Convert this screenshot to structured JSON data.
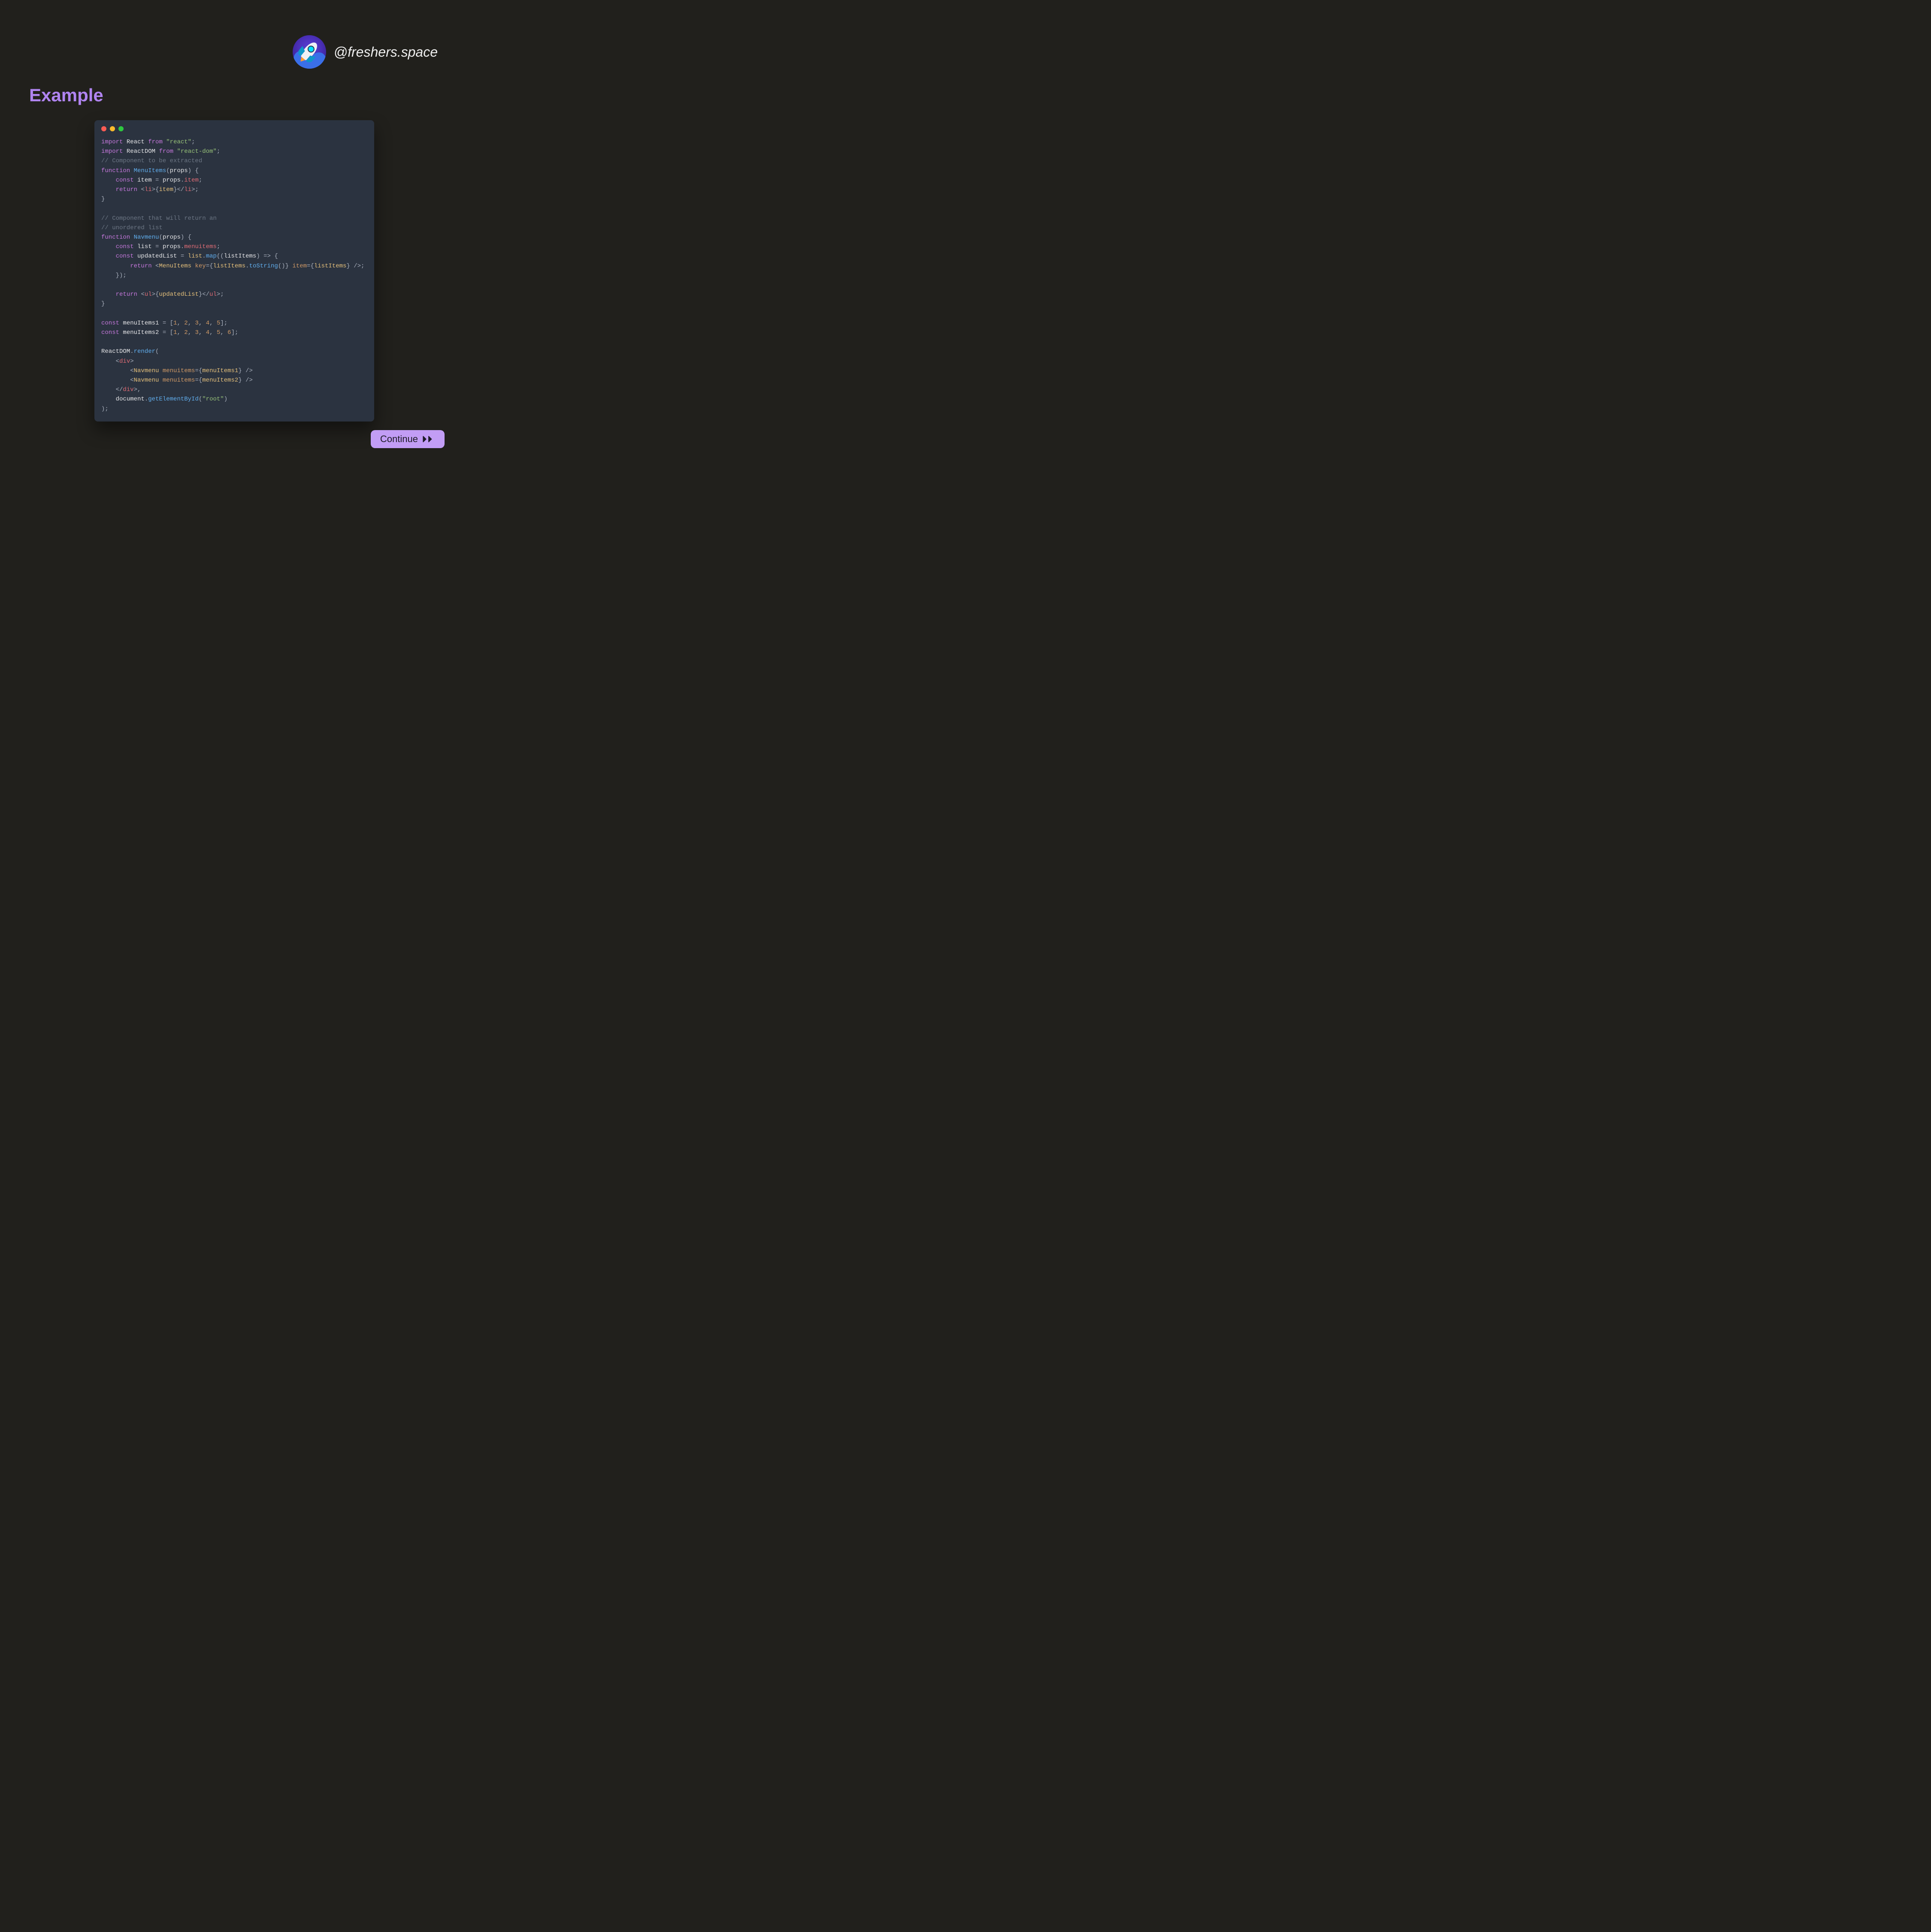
{
  "brand": {
    "handle": "@freshers.space",
    "avatar_alt": "rocket-avatar"
  },
  "title": "Example",
  "code": {
    "language": "javascript",
    "imports": [
      {
        "name": "React",
        "from": "react"
      },
      {
        "name": "ReactDOM",
        "from": "react-dom"
      }
    ],
    "comment_extracted": "// Component to be extracted",
    "fn_menuitems": {
      "name": "MenuItems",
      "param": "props",
      "const_item_lhs": "item",
      "const_item_rhs_obj": "props",
      "const_item_rhs_prop": "item",
      "return_tag": "li",
      "return_expr": "item"
    },
    "comment_navmenu_1": "// Component that will return an",
    "comment_navmenu_2": "// unordered list",
    "fn_navmenu": {
      "name": "Navmenu",
      "param": "props",
      "const_list_lhs": "list",
      "const_list_rhs_obj": "props",
      "const_list_rhs_prop": "menuitems",
      "const_upd_lhs": "updatedList",
      "map_src": "list",
      "map_call": "map",
      "map_arg": "listItems",
      "map_return_comp": "MenuItems",
      "map_key_attr": "key",
      "map_key_obj": "listItems",
      "map_key_call": "toString",
      "map_item_attr": "item",
      "map_item_val": "listItems",
      "return_tag": "ul",
      "return_expr": "updatedList"
    },
    "arrays": {
      "a1_name": "menuItems1",
      "a1_values": [
        "1",
        "2",
        "3",
        "4",
        "5"
      ],
      "a2_name": "menuItems2",
      "a2_values": [
        "1",
        "2",
        "3",
        "4",
        "5",
        "6"
      ]
    },
    "render": {
      "obj": "ReactDOM",
      "call": "render",
      "wrap_tag": "div",
      "children": [
        {
          "comp": "Navmenu",
          "attr": "menuitems",
          "val": "menuItems1"
        },
        {
          "comp": "Navmenu",
          "attr": "menuitems",
          "val": "menuItems2"
        }
      ],
      "doc_obj": "document",
      "doc_call": "getElementById",
      "doc_arg": "root"
    }
  },
  "button": {
    "label": "Continue"
  }
}
